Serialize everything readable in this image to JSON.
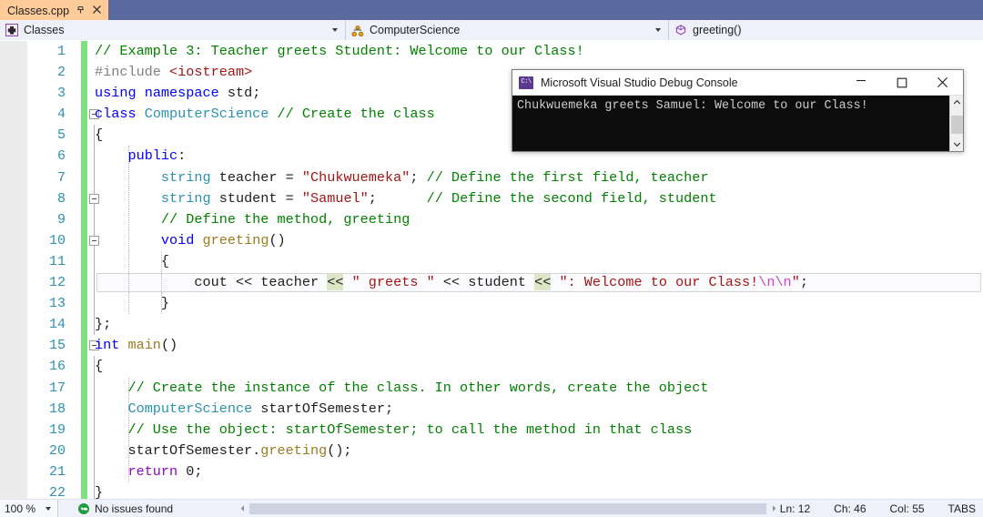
{
  "tab": {
    "title": "Classes.cpp",
    "pin_icon": "pin-icon",
    "close_icon": "close-icon"
  },
  "navbar": {
    "project": {
      "label": "Classes",
      "icon": "class-project-icon"
    },
    "class": {
      "label": "ComputerScience",
      "icon": "class-icon"
    },
    "member": {
      "label": "greeting()",
      "icon": "method-icon"
    }
  },
  "editor": {
    "current_line": 12,
    "lines": [
      {
        "n": 1,
        "tokens": [
          {
            "t": "// Example 3: Teacher greets Student: Welcome to our Class!",
            "c": "t-com"
          }
        ]
      },
      {
        "n": 2,
        "tokens": [
          {
            "t": "#include ",
            "c": "t-pre"
          },
          {
            "t": "<iostream>",
            "c": "t-kw2"
          }
        ]
      },
      {
        "n": 3,
        "tokens": [
          {
            "t": "using",
            "c": "t-kw"
          },
          {
            "t": " ",
            "c": "t-op"
          },
          {
            "t": "namespace",
            "c": "t-kw"
          },
          {
            "t": " std;",
            "c": "t-op"
          }
        ]
      },
      {
        "n": 4,
        "collapse": true,
        "tokens": [
          {
            "t": "class",
            "c": "t-kw"
          },
          {
            "t": " ",
            "c": "t-op"
          },
          {
            "t": "ComputerScience",
            "c": "t-type"
          },
          {
            "t": " ",
            "c": "t-op"
          },
          {
            "t": "// Create the class",
            "c": "t-com"
          }
        ]
      },
      {
        "n": 5,
        "tokens": [
          {
            "t": "{",
            "c": "t-op"
          }
        ]
      },
      {
        "n": 6,
        "tokens": [
          {
            "t": "    ",
            "c": "t-op"
          },
          {
            "t": "public",
            "c": "t-kw"
          },
          {
            "t": ":",
            "c": "t-op"
          }
        ]
      },
      {
        "n": 7,
        "tokens": [
          {
            "t": "        ",
            "c": "t-op"
          },
          {
            "t": "string",
            "c": "t-type"
          },
          {
            "t": " teacher = ",
            "c": "t-op"
          },
          {
            "t": "\"Chukwuemeka\"",
            "c": "t-str"
          },
          {
            "t": "; ",
            "c": "t-op"
          },
          {
            "t": "// Define the first field, teacher",
            "c": "t-com"
          }
        ]
      },
      {
        "n": 8,
        "collapse": true,
        "tokens": [
          {
            "t": "        ",
            "c": "t-op"
          },
          {
            "t": "string",
            "c": "t-type"
          },
          {
            "t": " student = ",
            "c": "t-op"
          },
          {
            "t": "\"Samuel\"",
            "c": "t-str"
          },
          {
            "t": ";      ",
            "c": "t-op"
          },
          {
            "t": "// Define the second field, student",
            "c": "t-com"
          }
        ]
      },
      {
        "n": 9,
        "tokens": [
          {
            "t": "        ",
            "c": "t-op"
          },
          {
            "t": "// Define the method, greeting",
            "c": "t-com"
          }
        ]
      },
      {
        "n": 10,
        "collapse": true,
        "tokens": [
          {
            "t": "        ",
            "c": "t-op"
          },
          {
            "t": "void",
            "c": "t-kw"
          },
          {
            "t": " ",
            "c": "t-op"
          },
          {
            "t": "greeting",
            "c": "t-fn"
          },
          {
            "t": "()",
            "c": "t-op"
          }
        ]
      },
      {
        "n": 11,
        "tokens": [
          {
            "t": "        {",
            "c": "t-op"
          }
        ]
      },
      {
        "n": 12,
        "current": true,
        "tokens": [
          {
            "t": "            cout ",
            "c": "t-op"
          },
          {
            "t": "<<",
            "c": "t-op"
          },
          {
            "t": " teacher ",
            "c": "t-op"
          },
          {
            "t": "<<",
            "c": "t-opHL"
          },
          {
            "t": " ",
            "c": "t-op"
          },
          {
            "t": "\" greets \"",
            "c": "t-str"
          },
          {
            "t": " ",
            "c": "t-op"
          },
          {
            "t": "<<",
            "c": "t-op"
          },
          {
            "t": " student ",
            "c": "t-op"
          },
          {
            "t": "<<",
            "c": "t-opHL"
          },
          {
            "t": " ",
            "c": "t-op"
          },
          {
            "t": "\": Welcome to our Class!",
            "c": "t-str"
          },
          {
            "t": "\\n\\n",
            "c": "t-esc"
          },
          {
            "t": "\"",
            "c": "t-str"
          },
          {
            "t": ";",
            "c": "t-op"
          }
        ]
      },
      {
        "n": 13,
        "tokens": [
          {
            "t": "        }",
            "c": "t-op"
          }
        ]
      },
      {
        "n": 14,
        "tokens": [
          {
            "t": "};",
            "c": "t-op"
          }
        ]
      },
      {
        "n": 15,
        "collapse": true,
        "tokens": [
          {
            "t": "int",
            "c": "t-kw"
          },
          {
            "t": " ",
            "c": "t-op"
          },
          {
            "t": "main",
            "c": "t-fn"
          },
          {
            "t": "()",
            "c": "t-op"
          }
        ]
      },
      {
        "n": 16,
        "tokens": [
          {
            "t": "{",
            "c": "t-op"
          }
        ]
      },
      {
        "n": 17,
        "tokens": [
          {
            "t": "    ",
            "c": "t-op"
          },
          {
            "t": "// Create the instance of the class. In other words, create the object",
            "c": "t-com"
          }
        ]
      },
      {
        "n": 18,
        "tokens": [
          {
            "t": "    ",
            "c": "t-op"
          },
          {
            "t": "ComputerScience",
            "c": "t-type"
          },
          {
            "t": " startOfSemester;",
            "c": "t-op"
          }
        ]
      },
      {
        "n": 19,
        "tokens": [
          {
            "t": "    ",
            "c": "t-op"
          },
          {
            "t": "// Use the object: startOfSemester; to call the method in that class",
            "c": "t-com"
          }
        ]
      },
      {
        "n": 20,
        "tokens": [
          {
            "t": "    startOfSemester.",
            "c": "t-op"
          },
          {
            "t": "greeting",
            "c": "t-fn"
          },
          {
            "t": "();",
            "c": "t-op"
          }
        ]
      },
      {
        "n": 21,
        "tokens": [
          {
            "t": "    ",
            "c": "t-op"
          },
          {
            "t": "return",
            "c": "t-ctl"
          },
          {
            "t": " 0;",
            "c": "t-op"
          }
        ]
      },
      {
        "n": 22,
        "tokens": [
          {
            "t": "}",
            "c": "t-op"
          }
        ]
      }
    ]
  },
  "console": {
    "title": "Microsoft Visual Studio Debug Console",
    "icon": "console-app-icon",
    "icon_text": "C:\\",
    "output": "Chukwuemeka greets Samuel: Welcome to our Class!",
    "minimize_label": "–",
    "close_label": "✕",
    "scroll_up": "˄",
    "scroll_down": "˅"
  },
  "statusbar": {
    "zoom": "100 %",
    "issues": "No issues found",
    "issues_icon": "check-circle-icon",
    "line": "Ln: 12",
    "char": "Ch: 46",
    "col": "Col: 55",
    "tabs": "TABS",
    "scroll_left": "◀",
    "scroll_right": "▶"
  },
  "colors": {
    "tabstrip_bg": "#5b6a9e",
    "tab_active_bg": "#ffcc99",
    "navbar_bg": "#eef1f9",
    "comment": "#008000",
    "keyword": "#0000ff",
    "string": "#a31515",
    "type": "#2b91af",
    "control": "#8f08c4",
    "function": "#9b7a20",
    "escape": "#cc44cc",
    "linenumber": "#2b91af",
    "changebar": "#7ee07e",
    "console_bg": "#0c0c0c",
    "ok_green": "#1f9c3f"
  }
}
